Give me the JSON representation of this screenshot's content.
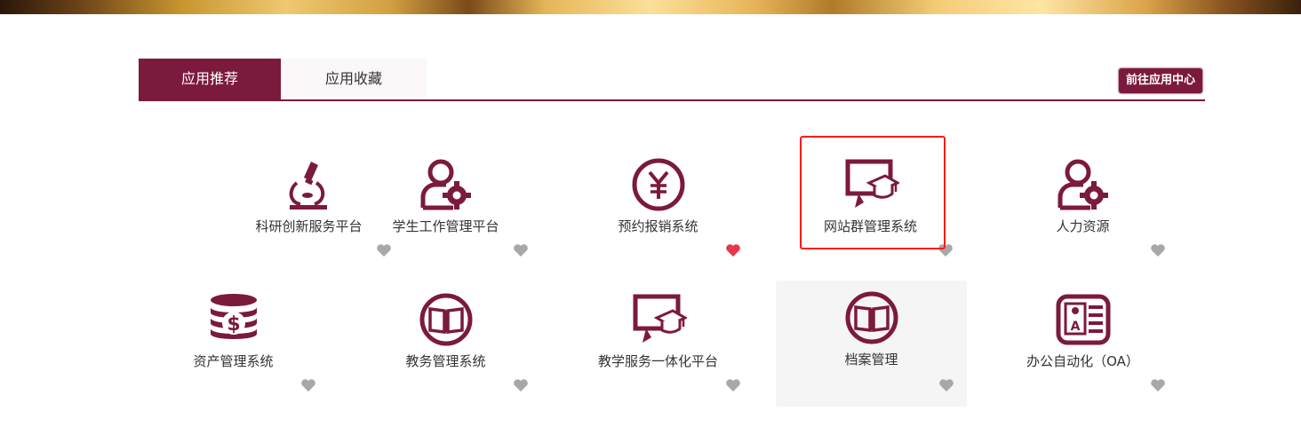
{
  "tabs": {
    "recommend": "应用推荐",
    "favorites": "应用收藏"
  },
  "goto_center": "前往应用中心",
  "colors": {
    "brand": "#7b1a3c",
    "heart_off": "#a8a8a8",
    "heart_on": "#e8364a",
    "highlight": "#ff1a1a"
  },
  "apps": [
    {
      "name": "科研创新服务平台",
      "icon": "microscope-icon",
      "favorited": false
    },
    {
      "name": "学生工作管理平台",
      "icon": "user-gear-icon",
      "favorited": false
    },
    {
      "name": "预约报销系统",
      "icon": "yen-icon",
      "favorited": true
    },
    {
      "name": "网站群管理系统",
      "icon": "monitor-graduation-icon",
      "favorited": false
    },
    {
      "name": "人力资源",
      "icon": "user-gear-icon",
      "favorited": false
    },
    {
      "name": "资产管理系统",
      "icon": "coins-dollar-icon",
      "favorited": false
    },
    {
      "name": "教务管理系统",
      "icon": "book-icon",
      "favorited": false
    },
    {
      "name": "教学服务一体化平台",
      "icon": "monitor-graduation-icon",
      "favorited": false
    },
    {
      "name": "档案管理",
      "icon": "book-icon",
      "favorited": false
    },
    {
      "name": "办公自动化（OA）",
      "icon": "id-card-icon",
      "favorited": false
    }
  ]
}
